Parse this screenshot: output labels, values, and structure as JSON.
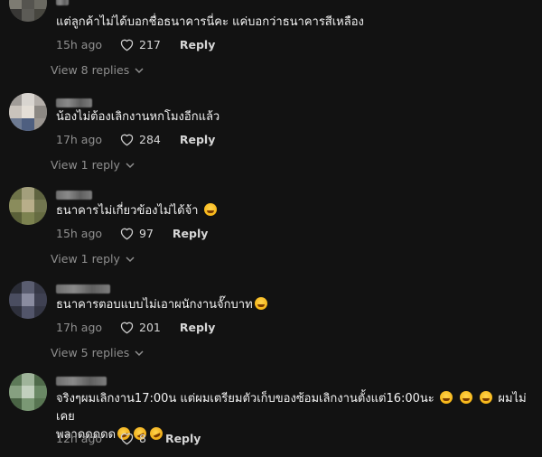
{
  "comments": [
    {
      "text": "แต่ลูกค้าไม่ได้บอกชื่อธนาคารนี่คะ แค่บอกว่าธนาคารสีเหลือง",
      "time": "15h ago",
      "likes": "217",
      "reply_label": "Reply",
      "view_replies": "View 8 replies"
    },
    {
      "text": "น้องไม่ต้องเลิกงานหกโมงอีกแล้ว",
      "time": "17h ago",
      "likes": "284",
      "reply_label": "Reply",
      "view_replies": "View 1 reply"
    },
    {
      "text": "ธนาคารไม่เกี่ยวข้องไม่ได้จ้า",
      "time": "15h ago",
      "likes": "97",
      "reply_label": "Reply",
      "view_replies": "View 1 reply"
    },
    {
      "text": "ธนาคารตอบแบบไม่เอาผนักงานจั๊กบาท",
      "time": "17h ago",
      "likes": "201",
      "reply_label": "Reply",
      "view_replies": "View 5 replies"
    },
    {
      "text_line1": "จริงๆผมเลิกงาน17:00น แต่ผมเตรียมตัวเก็บของซ้อมเลิกงานตั้งแต่16:00นะ",
      "text_line1_tail": "ผมไม่เคย",
      "text_line2": "พลาดดดดด",
      "time": "12h ago",
      "likes": "8",
      "reply_label": "Reply"
    }
  ],
  "icons": {
    "like": "heart-outline-icon",
    "expand": "chevron-down-icon",
    "emoji_smile": "grinning-face-emoji",
    "emoji_laugh": "laughing-face-emoji",
    "emoji_rofl": "rolling-laughing-emoji"
  },
  "colors": {
    "background": "#121212",
    "text": "#f2f2f2",
    "muted": "#8f8f8f"
  }
}
